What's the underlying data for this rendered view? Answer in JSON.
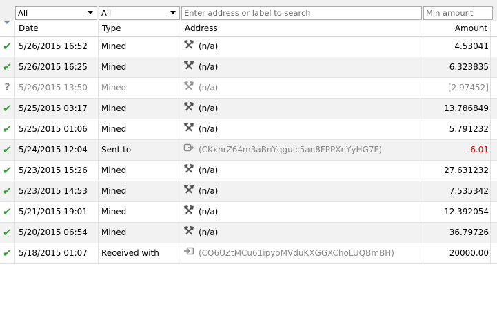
{
  "filters": {
    "date_value": "All",
    "type_value": "All",
    "search_placeholder": "Enter address or label to search",
    "amount_placeholder": "Min amount"
  },
  "columns": {
    "date": "Date",
    "type": "Type",
    "address": "Address",
    "amount": "Amount"
  },
  "rows": [
    {
      "status": "confirmed",
      "date": "5/26/2015 16:52",
      "type": "Mined",
      "icon": "mining-icon",
      "address": "(n/a)",
      "amount": "4.53041"
    },
    {
      "status": "confirmed",
      "date": "5/26/2015 16:25",
      "type": "Mined",
      "icon": "mining-icon",
      "address": "(n/a)",
      "amount": "6.323835"
    },
    {
      "status": "unconfirmed",
      "date": "5/26/2015 13:50",
      "type": "Mined",
      "icon": "mining-icon",
      "address": "(n/a)",
      "amount": "[2.97452]"
    },
    {
      "status": "confirmed",
      "date": "5/25/2015 03:17",
      "type": "Mined",
      "icon": "mining-icon",
      "address": "(n/a)",
      "amount": "13.786849"
    },
    {
      "status": "confirmed",
      "date": "5/25/2015 01:06",
      "type": "Mined",
      "icon": "mining-icon",
      "address": "(n/a)",
      "amount": "5.791232"
    },
    {
      "status": "confirmed",
      "date": "5/24/2015 12:04",
      "type": "Sent to",
      "icon": "send-icon",
      "address": "(CKxhrZ64m3aBnYqguic5an8FPPXnYyHG7F)",
      "amount": "-6.01"
    },
    {
      "status": "confirmed",
      "date": "5/23/2015 15:26",
      "type": "Mined",
      "icon": "mining-icon",
      "address": "(n/a)",
      "amount": "27.631232"
    },
    {
      "status": "confirmed",
      "date": "5/23/2015 14:53",
      "type": "Mined",
      "icon": "mining-icon",
      "address": "(n/a)",
      "amount": "7.535342"
    },
    {
      "status": "confirmed",
      "date": "5/21/2015 19:01",
      "type": "Mined",
      "icon": "mining-icon",
      "address": "(n/a)",
      "amount": "12.392054"
    },
    {
      "status": "confirmed",
      "date": "5/20/2015 06:54",
      "type": "Mined",
      "icon": "mining-icon",
      "address": "(n/a)",
      "amount": "36.79726"
    },
    {
      "status": "confirmed",
      "date": "5/18/2015 01:07",
      "type": "Received with",
      "icon": "receive-icon",
      "address": "(CQ6UZtMCu61ipyoMVduKXGGXChoLUQBmBH)",
      "amount": "20000.00"
    }
  ],
  "colors": {
    "confirmed_check": "#2da52d",
    "negative_amount": "#e00000",
    "muted_text": "#8a8a8a"
  }
}
